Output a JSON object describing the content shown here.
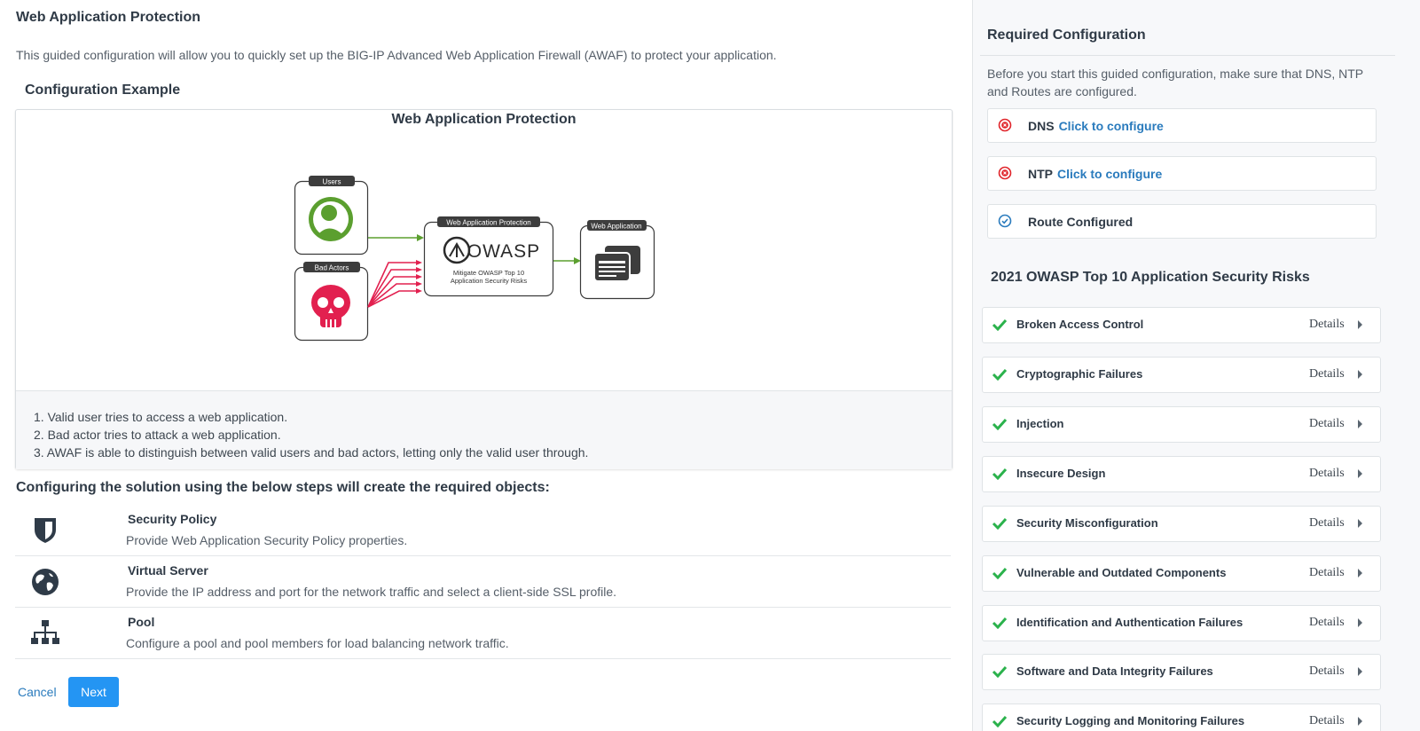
{
  "page": {
    "title": "Web Application Protection",
    "intro": "This guided configuration will allow you to quickly set up the BIG-IP Advanced Web Application Firewall (AWAF) to protect your application."
  },
  "example": {
    "section_title": "Configuration Example",
    "diagram_title": "Web Application Protection",
    "diagram": {
      "users_label": "Users",
      "bad_actors_label": "Bad Actors",
      "protection_label": "Web Application Protection",
      "owasp_wordmark": "OWASP",
      "mitigate_line1": "Mitigate OWASP Top 10",
      "mitigate_line2": "Application Security Risks",
      "webapp_label": "Web Application"
    },
    "steps": [
      "1. Valid user tries to access a web application.",
      "2. Bad actor tries to attack a web application.",
      "3. AWAF is able to distinguish between valid users and bad actors, letting only the valid user through."
    ]
  },
  "configuring": {
    "title": "Configuring the solution using the below steps will create the required objects:",
    "items": [
      {
        "title": "Security Policy",
        "description": "Provide Web Application Security Policy properties.",
        "icon": "shield-icon"
      },
      {
        "title": "Virtual Server",
        "description": "Provide the IP address and port for the network traffic and select a client-side SSL profile.",
        "icon": "globe-icon"
      },
      {
        "title": "Pool",
        "description": "Configure a pool and pool members for load balancing network traffic.",
        "icon": "sitemap-icon"
      }
    ]
  },
  "actions": {
    "cancel": "Cancel",
    "next": "Next"
  },
  "sidebar": {
    "title": "Required Configuration",
    "intro": "Before you start this guided configuration, make sure that DNS, NTP and Routes are configured.",
    "requirements": [
      {
        "label": "DNS",
        "link": "Click to configure",
        "status": "error"
      },
      {
        "label": "NTP",
        "link": "Click to configure",
        "status": "error"
      },
      {
        "label": "Route Configured",
        "link": "",
        "status": "ok"
      }
    ],
    "owasp_title": "2021 OWASP Top 10 Application Security Risks",
    "details_label": "Details",
    "risks": [
      "Broken Access Control",
      "Cryptographic Failures",
      "Injection",
      "Insecure Design",
      "Security Misconfiguration",
      "Vulnerable and Outdated Components",
      "Identification and Authentication Failures",
      "Software and Data Integrity Failures",
      "Security Logging and Monitoring Failures"
    ]
  },
  "colors": {
    "accent": "#2495f3",
    "link": "#2a7bbd",
    "error": "#e0242a",
    "ok_check": "#2bb24c",
    "user_green": "#5b9f2f",
    "attacker_red": "#e2204f"
  }
}
